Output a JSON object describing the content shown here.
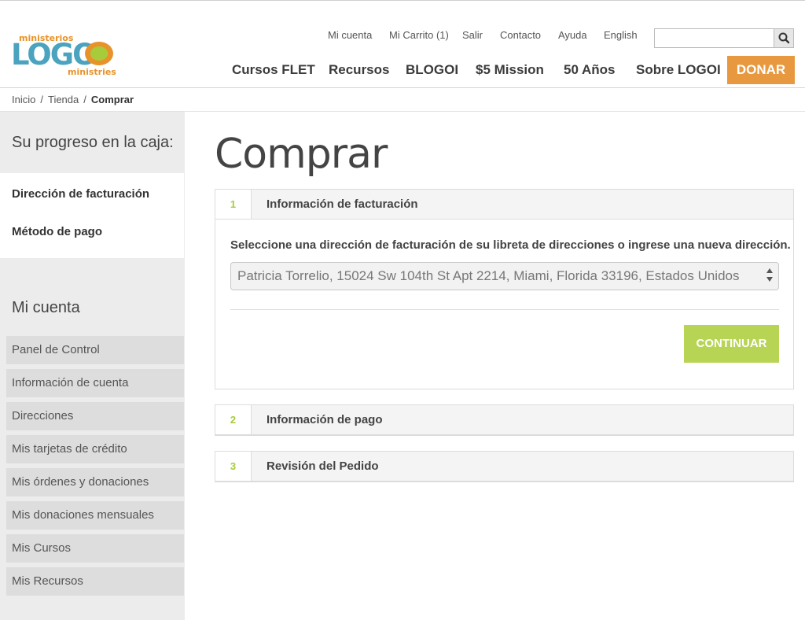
{
  "brand": {
    "top_text": "ministerios",
    "logo_text": "LOGOI",
    "bottom_text": "ministries"
  },
  "util_nav": [
    "Mi cuenta",
    "Mi Carrito (1)",
    "Salir",
    "Contacto",
    "Ayuda",
    "English"
  ],
  "search": {
    "value": "",
    "icon": "search-icon"
  },
  "main_nav": [
    "Cursos FLET",
    "Recursos",
    "BLOGOI",
    "$5 Mission",
    "50 Años",
    "Sobre LOGOI"
  ],
  "donate_label": "DONAR",
  "breadcrumb": {
    "items": [
      "Inicio",
      "Tienda"
    ],
    "current": "Comprar"
  },
  "sidebar": {
    "progress_title": "Su progreso en la caja:",
    "progress_items": [
      "Dirección de facturación",
      "Método de pago"
    ],
    "account_title": "Mi cuenta",
    "account_items": [
      "Panel de Control",
      "Información de cuenta",
      "Direcciones",
      "Mis tarjetas de crédito",
      "Mis órdenes y donaciones",
      "Mis donaciones mensuales",
      "Mis Cursos",
      "Mis Recursos"
    ]
  },
  "page_title": "Comprar",
  "steps": [
    {
      "number": "1",
      "label": "Información de facturación",
      "instruction": "Seleccione una dirección de facturación de su libreta de direcciones o ingrese una nueva dirección.",
      "selected_address": "Patricia Torrelio, 15024 Sw 104th St Apt 2214, Miami, Florida 33196, Estados Unidos",
      "button_label": "CONTINUAR"
    },
    {
      "number": "2",
      "label": "Información de pago"
    },
    {
      "number": "3",
      "label": "Revisión del Pedido"
    }
  ],
  "colors": {
    "donate": "#e8983e",
    "accent_green": "#b7d454",
    "step_number": "#a7cb3a",
    "logo_blue": "#4ba3bf",
    "logo_orange": "#e8932a"
  }
}
